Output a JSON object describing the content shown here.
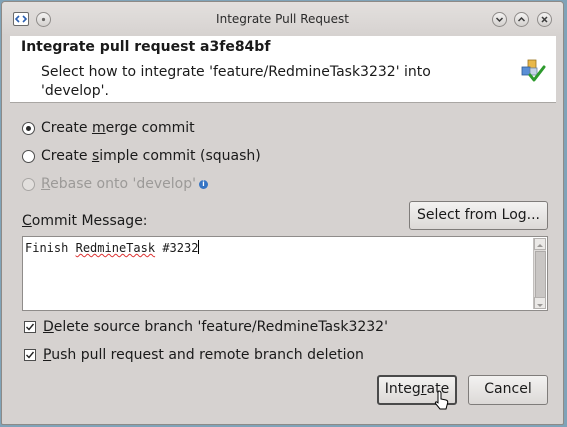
{
  "window": {
    "title": "Integrate Pull Request"
  },
  "header": {
    "title": "Integrate pull request a3fe84bf",
    "description": "Select how to integrate 'feature/RedmineTask3232' into 'develop'."
  },
  "options": {
    "merge": {
      "pre": "Create ",
      "accel": "m",
      "post": "erge commit",
      "selected": true
    },
    "simple": {
      "pre": "Create ",
      "accel": "s",
      "post": "imple commit (squash)",
      "selected": false
    },
    "rebase": {
      "pre": "",
      "accel": "R",
      "post": "ebase onto 'develop'",
      "enabled": false
    }
  },
  "commit": {
    "label_accel": "C",
    "label_rest": "ommit Message:",
    "select_log_label": "Select from Log...",
    "message_word1": "Finish",
    "message_word2": "RedmineTask",
    "message_word3": "#3232"
  },
  "checks": {
    "delete_branch": {
      "accel": "D",
      "rest": "elete source branch 'feature/RedmineTask3232'",
      "checked": true
    },
    "push": {
      "accel": "P",
      "rest": "ush pull request and remote branch deletion",
      "checked": true
    }
  },
  "buttons": {
    "integrate_pre": "Integ",
    "integrate_accel": "r",
    "integrate_post": "ate",
    "cancel": "Cancel"
  },
  "icons": {
    "app": "code-icon",
    "help": "help-icon",
    "minimize": "minimize-icon",
    "maximize": "maximize-icon",
    "close": "close-icon",
    "header": "integrate-merge-icon",
    "info": "info-icon"
  }
}
